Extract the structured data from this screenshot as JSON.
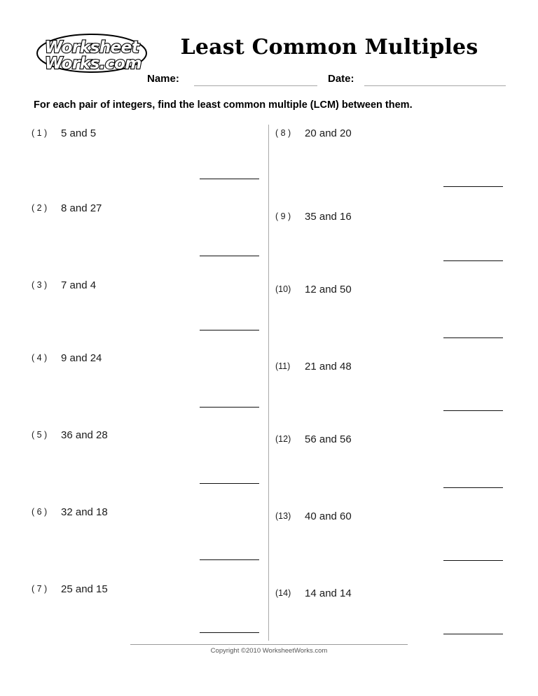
{
  "header": {
    "logo": {
      "name": "worksheetworks-logo",
      "line1": "Worksheet",
      "line2": "Works.com"
    },
    "title": "Least Common Multiples",
    "name_label": "Name:",
    "date_label": "Date:",
    "name_value": "",
    "date_value": ""
  },
  "instructions": "For each pair of integers, find the least common multiple (LCM) between them.",
  "columns": {
    "left": [
      {
        "number": "( 1 )",
        "text": "5 and 5",
        "answer": ""
      },
      {
        "number": "( 2 )",
        "text": "8 and 27",
        "answer": ""
      },
      {
        "number": "( 3 )",
        "text": "7 and 4",
        "answer": ""
      },
      {
        "number": "( 4 )",
        "text": "9 and 24",
        "answer": ""
      },
      {
        "number": "( 5 )",
        "text": "36 and 28",
        "answer": ""
      },
      {
        "number": "( 6 )",
        "text": "32 and 18",
        "answer": ""
      },
      {
        "number": "( 7 )",
        "text": "25 and 15",
        "answer": ""
      }
    ],
    "right": [
      {
        "number": "( 8 )",
        "text": "20 and 20",
        "answer": ""
      },
      {
        "number": "( 9 )",
        "text": "35 and 16",
        "answer": ""
      },
      {
        "number": "(10)",
        "text": "12 and 50",
        "answer": ""
      },
      {
        "number": "(11)",
        "text": "21 and 48",
        "answer": ""
      },
      {
        "number": "(12)",
        "text": "56 and 56",
        "answer": ""
      },
      {
        "number": "(13)",
        "text": "40 and 60",
        "answer": ""
      },
      {
        "number": "(14)",
        "text": "14 and 14",
        "answer": ""
      }
    ]
  },
  "footer": {
    "copyright": "Copyright ©2010 WorksheetWorks.com"
  },
  "colors": {
    "ink": "#000000",
    "rule_light": "#a8a8a8",
    "rule_dark": "#111111",
    "footer_text": "#555555"
  }
}
